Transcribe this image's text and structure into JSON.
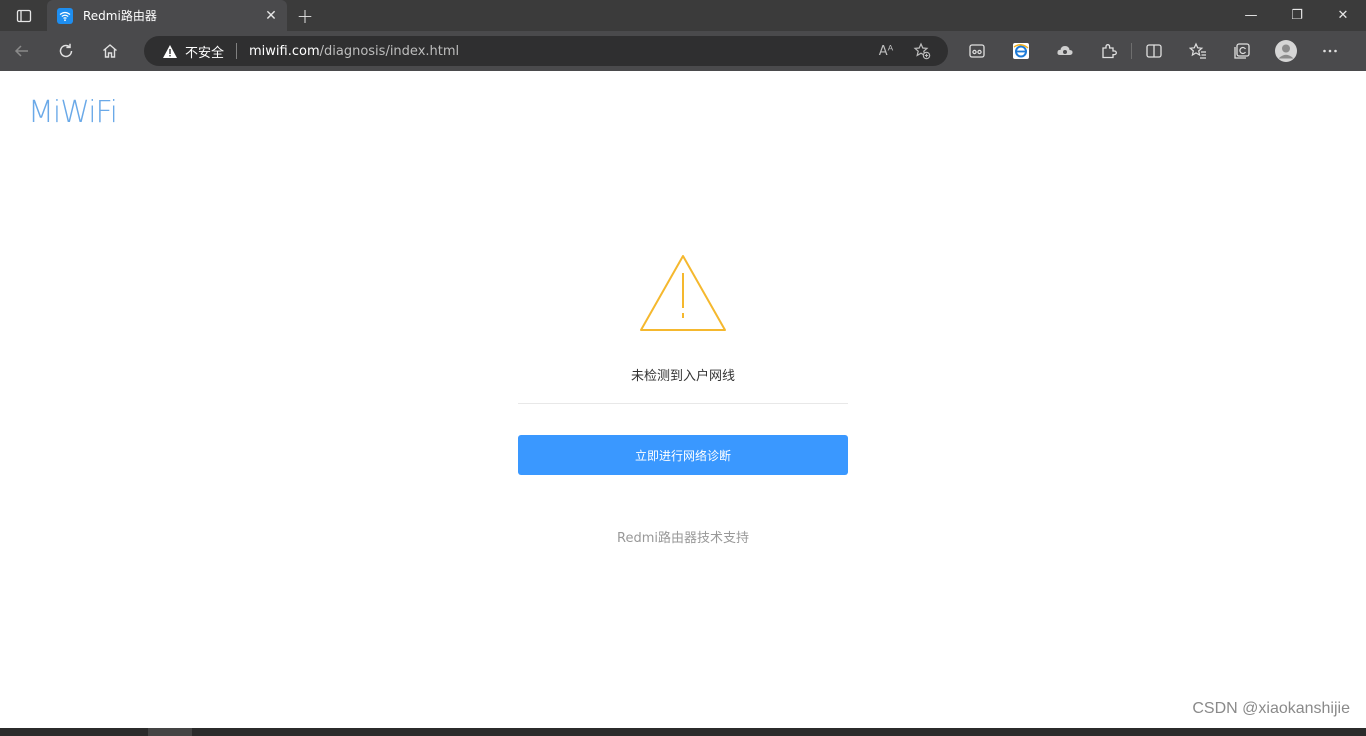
{
  "browser": {
    "tab": {
      "title": "Redmi路由器",
      "close_glyph": "✕"
    },
    "new_tab_glyph": "+",
    "window_controls": {
      "minimize": "—",
      "restore": "❐",
      "close": "✕"
    },
    "address_bar": {
      "security_warning": "不安全",
      "url_host": "miwifi.com",
      "url_path": "/diagnosis/index.html",
      "read_aloud_glyph": "Aᴬ"
    }
  },
  "page": {
    "logo": "MiWiFi",
    "status_message": "未检测到入户网线",
    "diagnose_button": "立即进行网络诊断",
    "support_link": "Redmi路由器技术支持",
    "accent_color": "#3a98ff",
    "warning_color": "#f5b82e"
  },
  "watermark": "CSDN @xiaokanshijie"
}
